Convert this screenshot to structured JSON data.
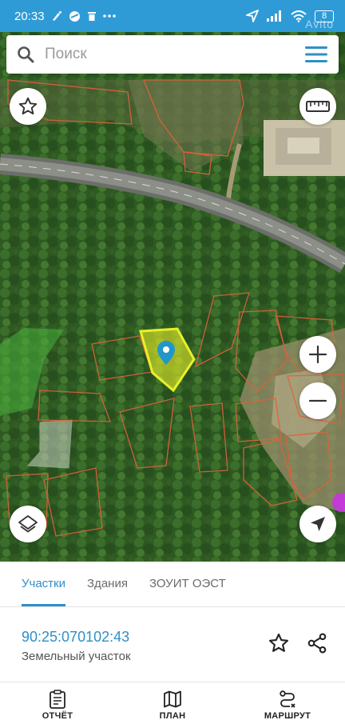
{
  "status_bar": {
    "time": "20:33",
    "battery": "8",
    "watermark": "Avito"
  },
  "search": {
    "placeholder": "Поиск"
  },
  "map": {
    "selected_parcel_color": "#e8f028",
    "parcel_outline_color": "#e0613b",
    "pin_color": "#2196c9"
  },
  "tabs": [
    {
      "label": "Участки",
      "active": true
    },
    {
      "label": "Здания",
      "active": false
    },
    {
      "label": "ЗОУИТ ОЭСТ",
      "active": false
    }
  ],
  "parcel": {
    "number": "90:25:070102:43",
    "type": "Земельный участок"
  },
  "bottom_nav": [
    {
      "label": "ОТЧЁТ",
      "icon": "report-icon"
    },
    {
      "label": "ПЛАН",
      "icon": "map-plan-icon"
    },
    {
      "label": "МАРШРУТ",
      "icon": "route-icon"
    }
  ],
  "colors": {
    "status_bar": "#2f9bd6",
    "accent": "#2f8fc6"
  }
}
